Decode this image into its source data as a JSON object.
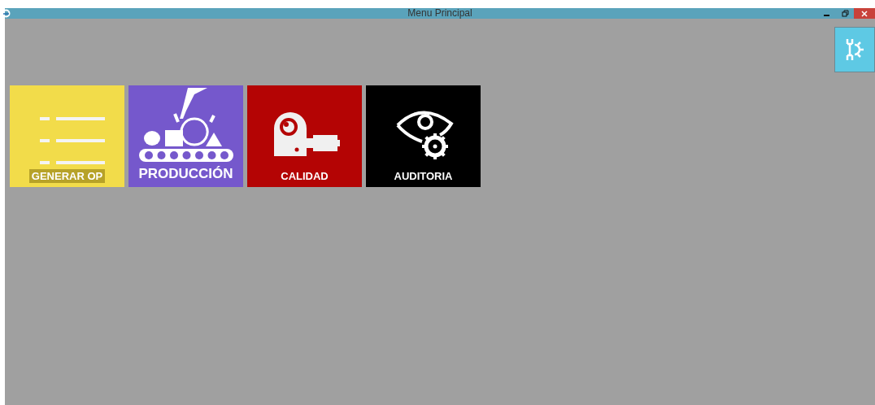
{
  "window": {
    "title": "Menu Principal"
  },
  "tiles": [
    {
      "label": "GENERAR OP",
      "kind": "list",
      "color": "#f2dc4a"
    },
    {
      "label": "PRODUCCIÓN",
      "kind": "conveyor",
      "color": "#7558cc"
    },
    {
      "label": "CALIDAD",
      "kind": "camera",
      "color": "#b40404"
    },
    {
      "label": "AUDITORIA",
      "kind": "eye",
      "color": "#000000"
    }
  ]
}
